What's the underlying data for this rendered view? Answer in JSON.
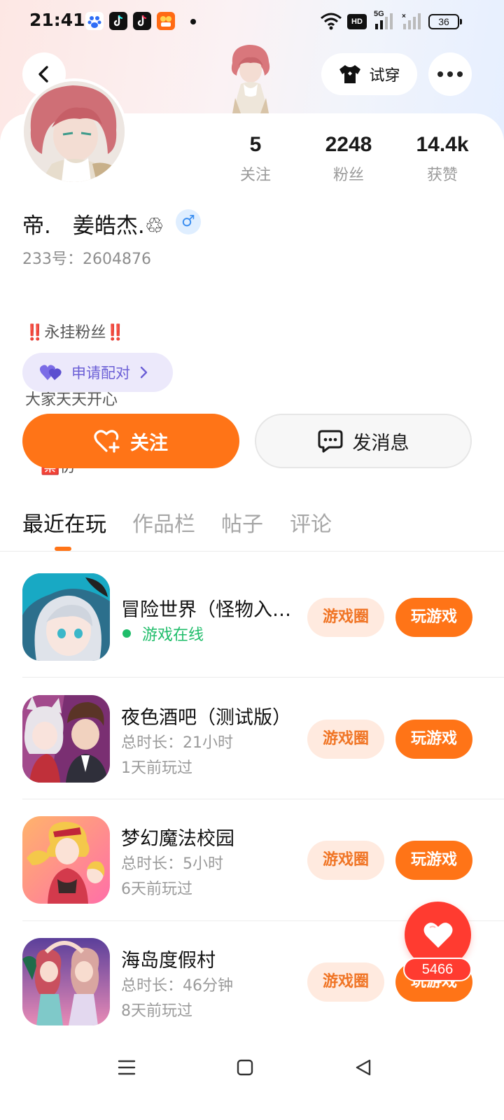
{
  "status_bar": {
    "time": "21:41",
    "network": "5G",
    "hd": "HD",
    "battery": "36"
  },
  "top_bar": {
    "try_on_label": "试穿"
  },
  "profile": {
    "name": "帝.　姜皓杰.♲",
    "gender_symbol": "♂",
    "id_label": "233号：2604876",
    "bio": [
      "‼️永挂粉丝‼️",
      "大家天天开心",
      "　🈲仿"
    ]
  },
  "stats": [
    {
      "value": "5",
      "label": "关注"
    },
    {
      "value": "2248",
      "label": "粉丝"
    },
    {
      "value": "14.4k",
      "label": "获赞"
    }
  ],
  "pair_button": {
    "label": "申请配对"
  },
  "actions": {
    "follow_label": "关注",
    "message_label": "发消息"
  },
  "tabs": [
    {
      "label": "最近在玩",
      "active": true
    },
    {
      "label": "作品栏",
      "active": false
    },
    {
      "label": "帖子",
      "active": false
    },
    {
      "label": "评论",
      "active": false
    }
  ],
  "games": [
    {
      "title": "冒险世界（怪物入…",
      "sub1": "游戏在线",
      "sub2": "",
      "online": true,
      "circle_label": "游戏圈",
      "play_label": "玩游戏"
    },
    {
      "title": "夜色酒吧（测试版）",
      "sub1": "总时长：21小时",
      "sub2": "1天前玩过",
      "online": false,
      "circle_label": "游戏圈",
      "play_label": "玩游戏"
    },
    {
      "title": "梦幻魔法校园",
      "sub1": "总时长：5小时",
      "sub2": "6天前玩过",
      "online": false,
      "circle_label": "游戏圈",
      "play_label": "玩游戏"
    },
    {
      "title": "海岛度假村",
      "sub1": "总时长：46分钟",
      "sub2": "8天前玩过",
      "online": false,
      "circle_label": "游戏圈",
      "play_label": "玩游戏"
    }
  ],
  "like_fab": {
    "count": "5466"
  },
  "colors": {
    "accent": "#ff7417",
    "online": "#1fbd6a",
    "like": "#ff3b30",
    "pair": "#6b5fd6"
  }
}
